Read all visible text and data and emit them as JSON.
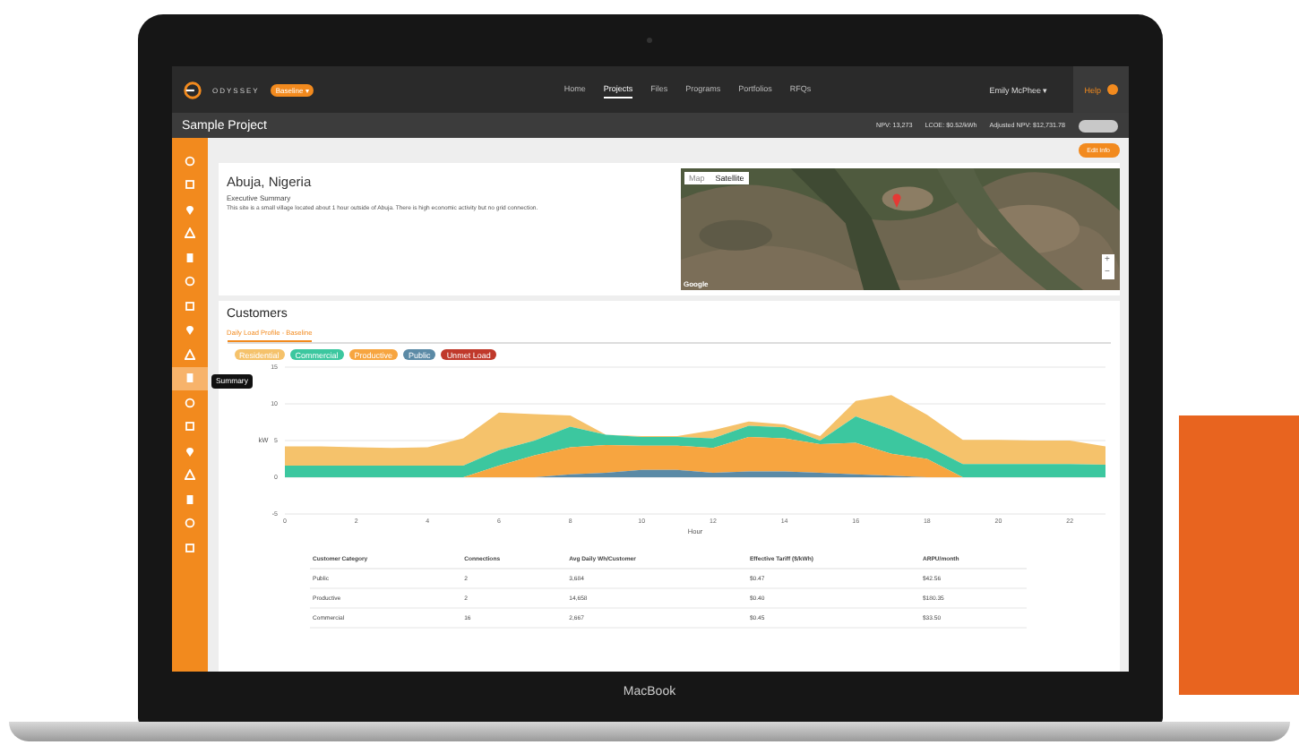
{
  "nav": {
    "brand": "ODYSSEY",
    "badge": "Baseline ▾",
    "links": [
      {
        "label": "Home",
        "selected": false
      },
      {
        "label": "Projects",
        "selected": true
      },
      {
        "label": "Files",
        "selected": false
      },
      {
        "label": "Programs",
        "selected": false
      },
      {
        "label": "Portfolios",
        "selected": false
      },
      {
        "label": "RFQs",
        "selected": false
      }
    ],
    "user": "Emily McPhee ▾",
    "help": "Help"
  },
  "project": {
    "title": "Sample Project",
    "stats": [
      "NPV: 13,273",
      "LCOE: $0.52/kWh",
      "Adjusted NPV: $12,731.78"
    ]
  },
  "sidebar": {
    "items": [
      {
        "selected": false
      },
      {
        "selected": false
      },
      {
        "selected": false
      },
      {
        "selected": false
      },
      {
        "selected": false
      },
      {
        "selected": false
      },
      {
        "selected": false
      },
      {
        "selected": false
      },
      {
        "selected": false
      },
      {
        "selected": true
      },
      {
        "selected": false
      },
      {
        "selected": false
      },
      {
        "selected": false
      },
      {
        "selected": false
      },
      {
        "selected": false
      },
      {
        "selected": false
      },
      {
        "selected": false
      }
    ],
    "tooltip": "Summary"
  },
  "action_button": "Edit Info",
  "site": {
    "title": "Abuja, Nigeria",
    "subtitle": "Executive Summary",
    "summary": "This site is a small village located about 1 hour outside of Abuja. There is high economic activity but no grid connection.",
    "map": {
      "kind": "picture",
      "map_types": [
        {
          "label": "Map",
          "selected": false
        },
        {
          "label": "Satellite",
          "selected": true
        }
      ],
      "zoom": [
        "+",
        "−"
      ],
      "logo": "Google"
    }
  },
  "customers": {
    "title": "Customers",
    "tab": "Daily Load Profile - Baseline",
    "chart_data": {
      "type": "area",
      "stacked": true,
      "xlabel": "Hour",
      "ylabel": "kW",
      "x": [
        0,
        1,
        2,
        3,
        4,
        5,
        6,
        7,
        8,
        9,
        10,
        11,
        12,
        13,
        14,
        15,
        16,
        17,
        18,
        19,
        20,
        21,
        22,
        23
      ],
      "xlim": [
        0,
        23
      ],
      "grid": true,
      "xticks": [
        0,
        2,
        4,
        6,
        8,
        10,
        12,
        14,
        16,
        18,
        20,
        22
      ],
      "yticks": [
        -5,
        0,
        5,
        10,
        15
      ],
      "ylim": [
        -5,
        15
      ],
      "series": [
        {
          "name": "Residential",
          "color": "#f5c26b",
          "values": [
            2.6,
            2.6,
            2.5,
            2.4,
            2.5,
            3.7,
            5.1,
            3.6,
            1.5,
            0,
            0.1,
            0.1,
            1.1,
            0.6,
            0.4,
            0.6,
            2.1,
            4.7,
            4.2,
            3.3,
            3.3,
            3.2,
            3.2,
            2.5
          ]
        },
        {
          "name": "Commercial",
          "color": "#3cc79f",
          "values": [
            1.6,
            1.6,
            1.6,
            1.6,
            1.6,
            1.6,
            2.1,
            2.0,
            2.8,
            1.4,
            1.2,
            1.2,
            1.3,
            1.5,
            1.5,
            0.5,
            3.6,
            3.3,
            1.8,
            1.8,
            1.8,
            1.8,
            1.8,
            1.7
          ]
        },
        {
          "name": "Productive",
          "color": "#f7a540",
          "values": [
            0,
            0,
            0,
            0,
            0,
            0,
            1.6,
            3.0,
            3.7,
            3.8,
            3.3,
            3.3,
            3.4,
            4.7,
            4.5,
            3.9,
            4.3,
            3.0,
            2.5,
            0,
            0,
            0,
            0,
            0
          ]
        },
        {
          "name": "Public",
          "color": "#5b8aa6",
          "values": [
            0,
            0,
            0,
            0,
            0,
            0,
            0,
            0,
            0.4,
            0.6,
            1.0,
            1.0,
            0.6,
            0.8,
            0.8,
            0.6,
            0.4,
            0.2,
            0,
            0,
            0,
            0,
            0,
            0
          ]
        },
        {
          "name": "Unmet Load",
          "color": "#c0392b",
          "values": [
            null,
            null,
            null,
            null,
            null,
            null,
            null,
            null,
            null,
            null,
            null,
            null,
            null,
            null,
            null,
            null,
            null,
            null,
            null,
            null,
            null,
            null,
            null,
            null
          ]
        }
      ]
    },
    "table": {
      "columns": [
        "Customer Category",
        "Connections",
        "Avg Daily Wh/Customer",
        "Effective Tariff ($/kWh)",
        "ARPU/month"
      ],
      "rows": [
        [
          "Public",
          "2",
          "3,684",
          "$0.47",
          "$42.56"
        ],
        [
          "Productive",
          "2",
          "14,658",
          "$0.40",
          "$180.35"
        ],
        [
          "Commercial",
          "16",
          "2,667",
          "$0.45",
          "$33.50"
        ]
      ]
    }
  },
  "laptop_label": "MacBook"
}
